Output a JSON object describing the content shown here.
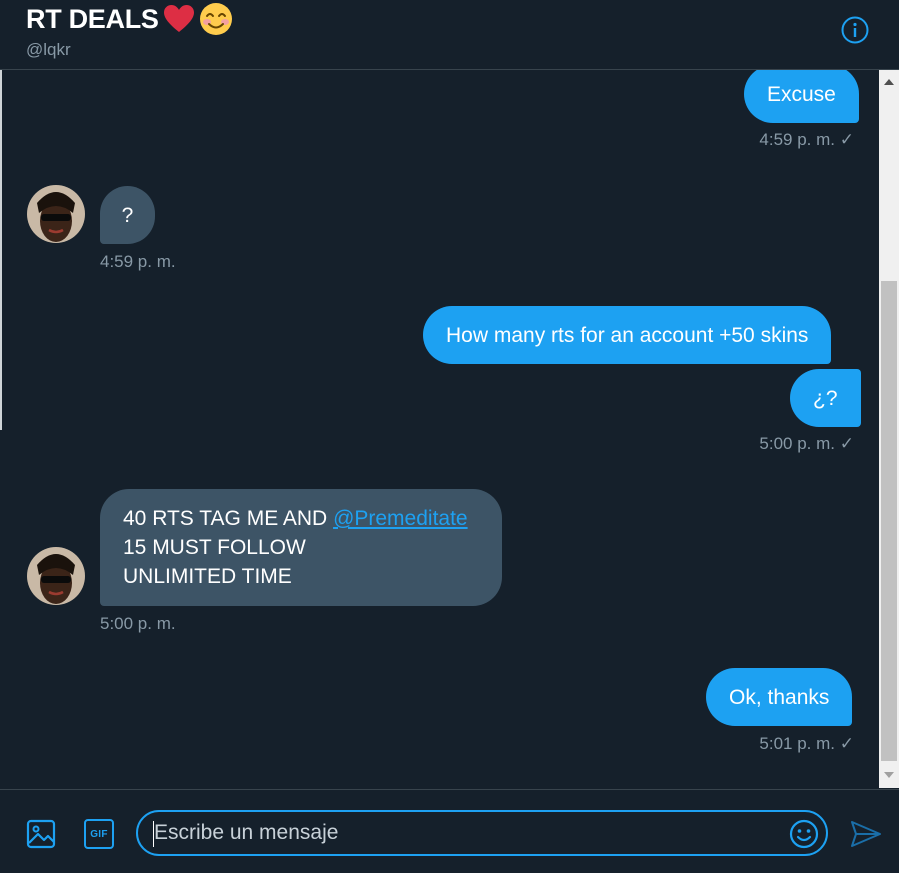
{
  "header": {
    "title": "RT DEALS",
    "title_emojis": [
      "red-heart",
      "smiling-face-with-smiling-eyes"
    ],
    "handle": "@lqkr",
    "info_icon": "info-icon"
  },
  "messages": [
    {
      "direction": "out",
      "text": "Excuse",
      "time": "4:59 p. m."
    },
    {
      "direction": "in",
      "text": "?",
      "time": "4:59 p. m."
    },
    {
      "direction": "out",
      "text": "How many rts for an account +50 skins"
    },
    {
      "direction": "out",
      "text": "¿?",
      "time": "5:00 p. m."
    },
    {
      "direction": "in",
      "line1_prefix": "40 RTS TAG ME AND ",
      "mention": "@Premeditate",
      "line2": "15 MUST FOLLOW",
      "line3": "UNLIMITED TIME",
      "time": "5:00 p. m."
    },
    {
      "direction": "out",
      "text": "Ok, thanks",
      "time": "5:01 p. m."
    }
  ],
  "read_mark": "✓",
  "composer": {
    "placeholder": "Escribe un mensaje",
    "media_icon": "image-icon",
    "gif_icon": "gif-icon",
    "gif_label": "GIF",
    "emoji_icon": "emoji-icon",
    "send_icon": "send-icon"
  },
  "colors": {
    "background": "#15202b",
    "accent": "#1da1f2",
    "incoming_bubble": "#3d5466",
    "muted_text": "#8899a6"
  }
}
